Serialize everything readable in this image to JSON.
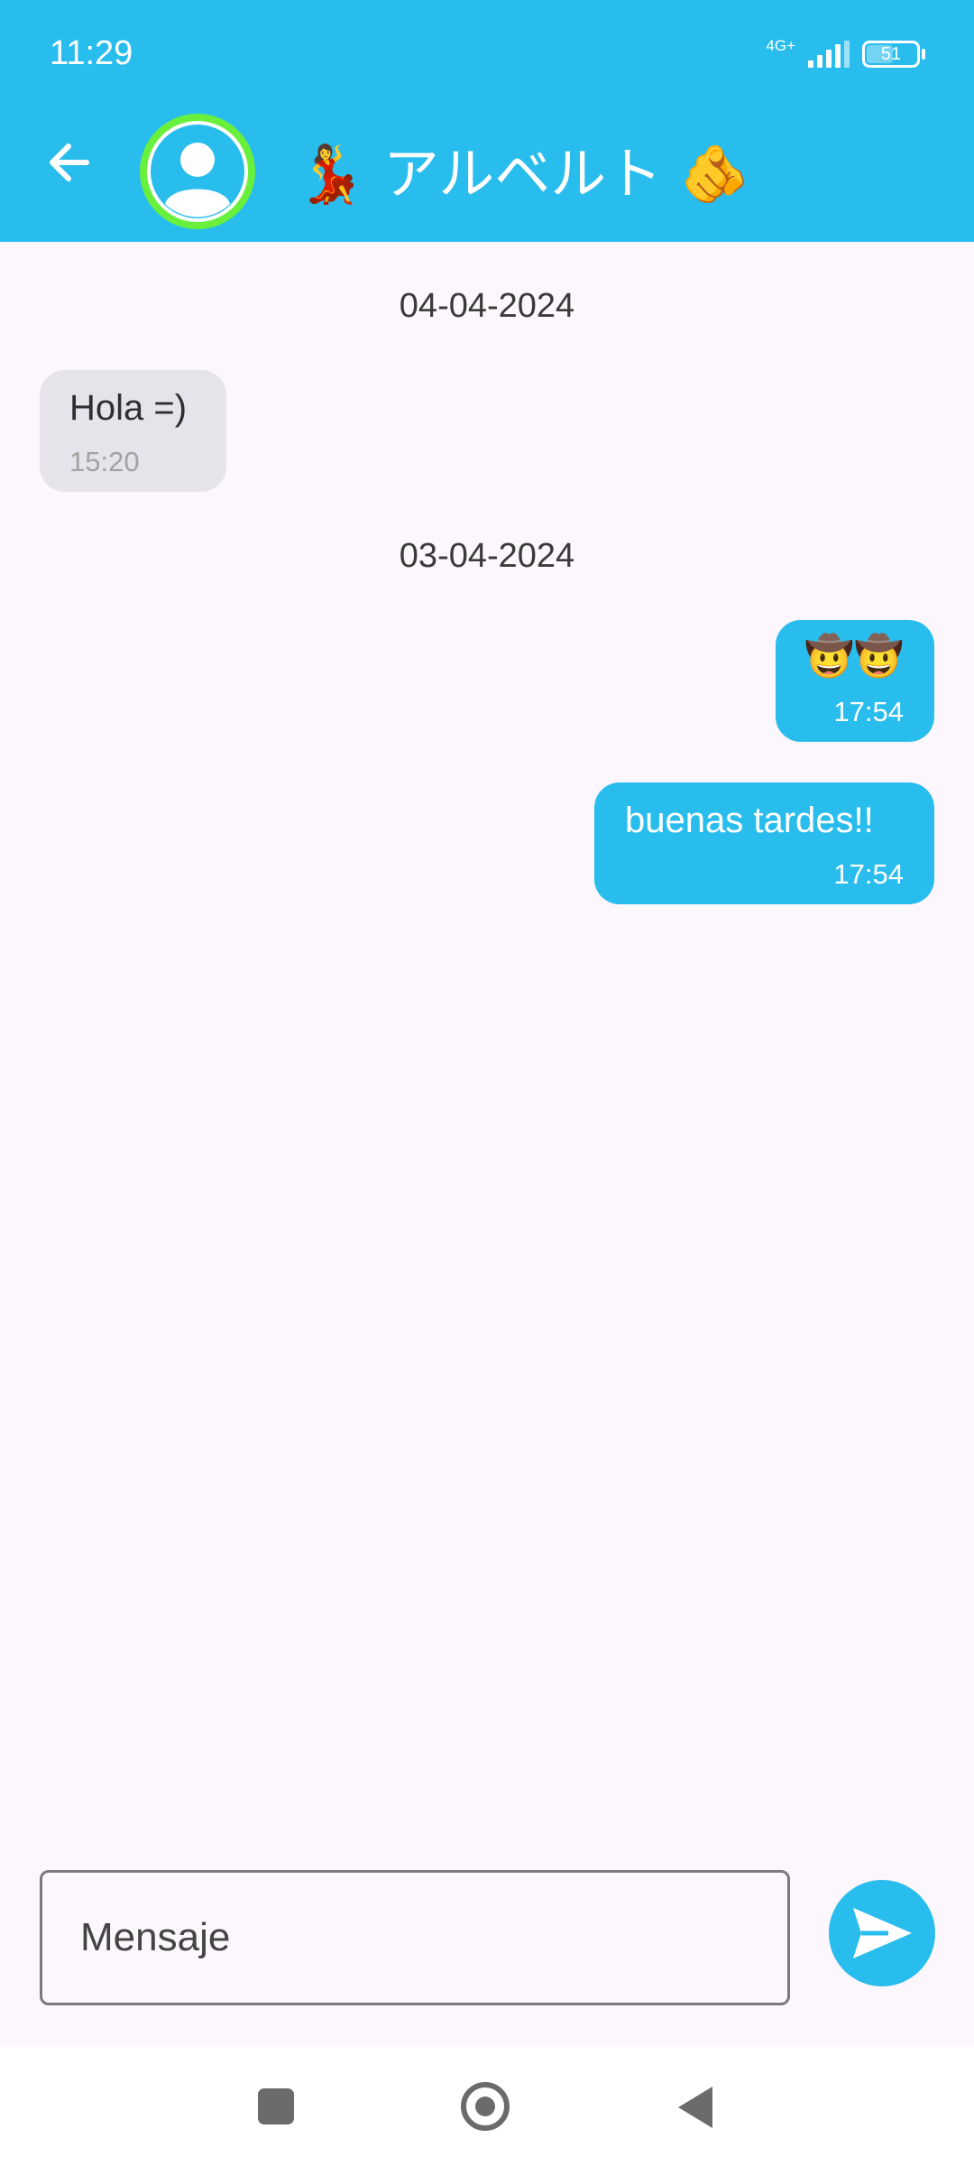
{
  "status_bar": {
    "time": "11:29",
    "network": "4G+",
    "battery": "51"
  },
  "header": {
    "contact_name": "💃 アルベルト 🫵"
  },
  "conversation": {
    "groups": [
      {
        "date": "04-04-2024",
        "messages": [
          {
            "text": "Hola =)",
            "time": "15:20",
            "direction": "incoming"
          }
        ]
      },
      {
        "date": "03-04-2024",
        "messages": [
          {
            "text": "🤠🤠",
            "time": "17:54",
            "direction": "outgoing"
          },
          {
            "text": "buenas tardes!!",
            "time": "17:54",
            "direction": "outgoing"
          }
        ]
      }
    ]
  },
  "composer": {
    "placeholder": "Mensaje"
  },
  "colors": {
    "accent": "#29bdee",
    "avatar_ring": "#69f03c",
    "incoming_bubble": "#e6e4ea",
    "background": "#fcf6fd"
  },
  "icons": [
    "arrow-back-icon",
    "user-avatar-icon",
    "send-icon",
    "recents-icon",
    "home-icon",
    "nav-back-icon"
  ]
}
